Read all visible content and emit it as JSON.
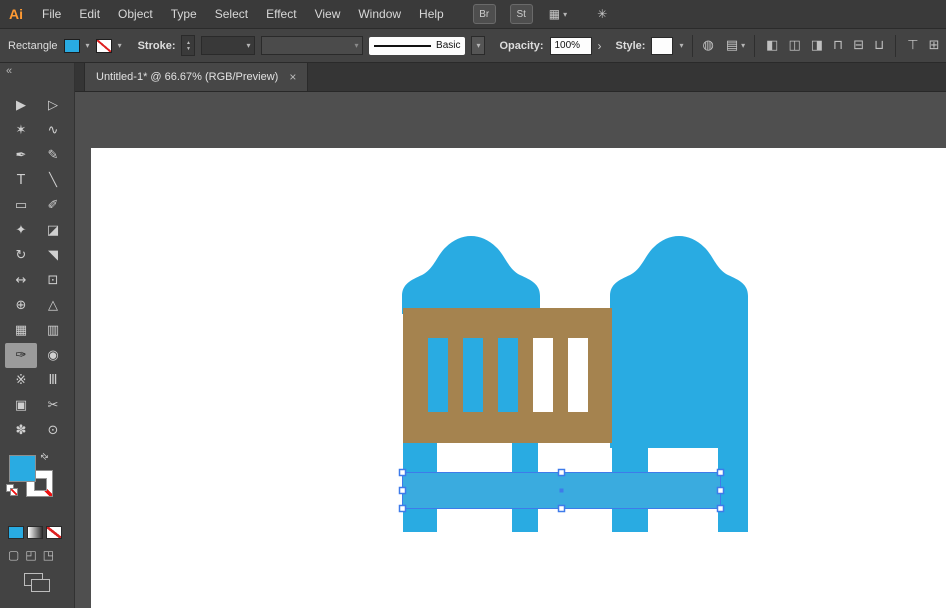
{
  "menubar": {
    "logo": "Ai",
    "items": [
      "File",
      "Edit",
      "Object",
      "Type",
      "Select",
      "Effect",
      "View",
      "Window",
      "Help"
    ],
    "bridge_label": "Br",
    "stock_label": "St",
    "workspace_icon": "▦",
    "caret": "▾",
    "touch_icon": "✳"
  },
  "control_bar": {
    "context_label": "Rectangle",
    "caret": "▾",
    "stroke_label": "Stroke:",
    "stepper_up": "▲",
    "stepper_down": "▼",
    "stroke_style_value": "Basic",
    "opacity_label": "Opacity:",
    "opacity_value": "100%",
    "opacity_arrow": "›",
    "style_label": "Style:",
    "globe_icon": "◍",
    "doc_setup_icon": "▤",
    "align_icons": [
      "◧",
      "◫",
      "◨",
      "⊓",
      "⊟",
      "⊔"
    ],
    "extra_icons": [
      "⊤",
      "⊞"
    ]
  },
  "document_tab": {
    "title": "Untitled-1* @ 66.67% (RGB/Preview)",
    "close": "×"
  },
  "toolbar": {
    "collapse": "«",
    "swap_icon": "⇄",
    "mode_icons": [
      "▢",
      "◰",
      "◳"
    ],
    "tools": [
      {
        "name": "selection-tool",
        "glyph": "▶"
      },
      {
        "name": "direct-selection-tool",
        "glyph": "▷"
      },
      {
        "name": "magic-wand-tool",
        "glyph": "✶"
      },
      {
        "name": "lasso-tool",
        "glyph": "∿"
      },
      {
        "name": "pen-tool",
        "glyph": "✒"
      },
      {
        "name": "curvature-tool",
        "glyph": "✎"
      },
      {
        "name": "type-tool",
        "glyph": "T"
      },
      {
        "name": "line-segment-tool",
        "glyph": "╲"
      },
      {
        "name": "rectangle-tool",
        "glyph": "▭"
      },
      {
        "name": "paintbrush-tool",
        "glyph": "✐"
      },
      {
        "name": "shaper-tool",
        "glyph": "✦"
      },
      {
        "name": "eraser-tool",
        "glyph": "◪"
      },
      {
        "name": "rotate-tool",
        "glyph": "↻"
      },
      {
        "name": "scale-tool",
        "glyph": "◥"
      },
      {
        "name": "width-tool",
        "glyph": "↔"
      },
      {
        "name": "free-transform-tool",
        "glyph": "⊡"
      },
      {
        "name": "shape-builder-tool",
        "glyph": "⊕"
      },
      {
        "name": "perspective-grid-tool",
        "glyph": "△"
      },
      {
        "name": "mesh-tool",
        "glyph": "▦"
      },
      {
        "name": "gradient-tool",
        "glyph": "▥"
      },
      {
        "name": "eyedropper-tool",
        "glyph": "✑",
        "selected": true
      },
      {
        "name": "blend-tool",
        "glyph": "◉"
      },
      {
        "name": "symbol-sprayer-tool",
        "glyph": "※"
      },
      {
        "name": "column-graph-tool",
        "glyph": "Ⅲ"
      },
      {
        "name": "artboard-tool",
        "glyph": "▣"
      },
      {
        "name": "slice-tool",
        "glyph": "✂"
      },
      {
        "name": "hand-tool",
        "glyph": "✽"
      },
      {
        "name": "zoom-tool",
        "glyph": "⊙"
      }
    ]
  },
  "artwork": {
    "colors": {
      "blue": "#29ABE2",
      "rail": "#3AABDF",
      "brown": "#A5834F",
      "white": "#FFFFFF",
      "selection": "#3E7BEA"
    }
  }
}
